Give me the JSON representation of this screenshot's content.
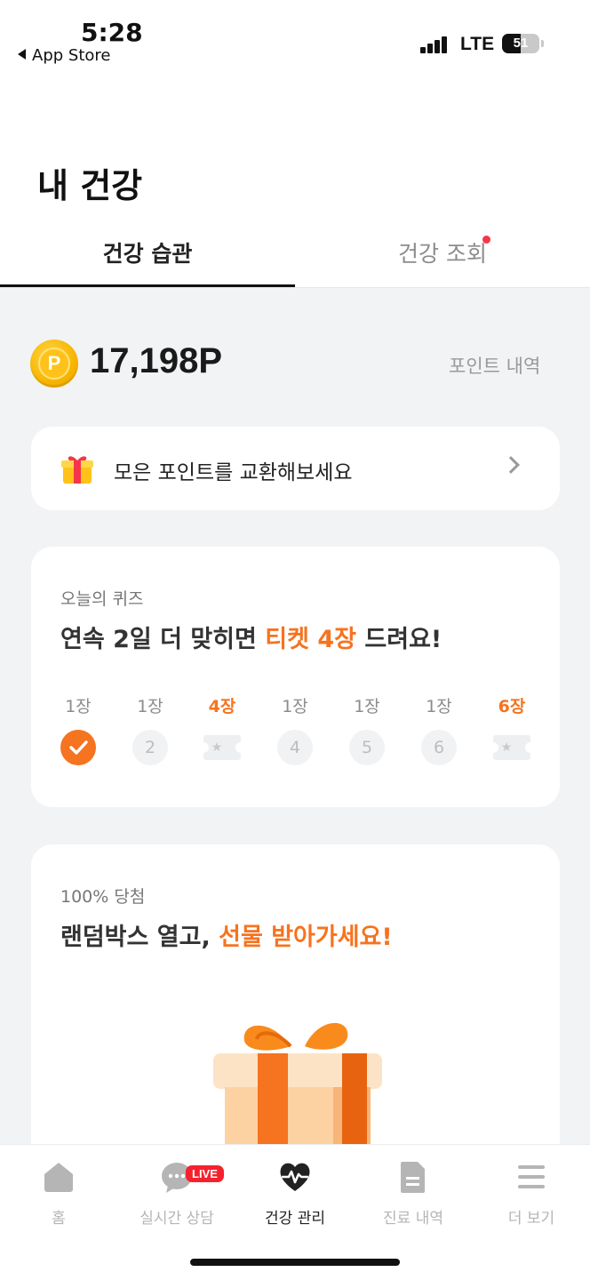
{
  "status_bar": {
    "time": "5:28",
    "back_label": "App Store",
    "network": "LTE",
    "battery": "51"
  },
  "header": {
    "title": "내 건강",
    "tabs": [
      {
        "label": "건강 습관",
        "active": true
      },
      {
        "label": "건강 조회",
        "active": false,
        "has_notification": true
      }
    ]
  },
  "points": {
    "coin_symbol": "P",
    "value": "17,198P",
    "history_label": "포인트 내역"
  },
  "exchange": {
    "label": "모은 포인트를 교환해보세요",
    "icon": "gift-icon"
  },
  "quiz": {
    "subtitle": "오늘의 퀴즈",
    "title_prefix": "연속 2일 더 맞히면 ",
    "title_highlight": "티켓 4장",
    "title_suffix": " 드려요!",
    "days": [
      {
        "reward": "1장",
        "marker": "",
        "state": "done"
      },
      {
        "reward": "1장",
        "marker": "2",
        "state": "upcoming"
      },
      {
        "reward": "4장",
        "marker": "★",
        "state": "ticket"
      },
      {
        "reward": "1장",
        "marker": "4",
        "state": "upcoming"
      },
      {
        "reward": "1장",
        "marker": "5",
        "state": "upcoming"
      },
      {
        "reward": "1장",
        "marker": "6",
        "state": "upcoming"
      },
      {
        "reward": "6장",
        "marker": "★",
        "state": "ticket"
      }
    ]
  },
  "random_box": {
    "subtitle": "100% 당첨",
    "title_prefix": "랜덤박스 열고, ",
    "title_highlight": "선물 받아가세요!"
  },
  "bottom_nav": {
    "items": [
      {
        "label": "홈",
        "icon": "home-icon",
        "active": false
      },
      {
        "label": "실시간 상담",
        "icon": "chat-icon",
        "active": false,
        "badge": "LIVE"
      },
      {
        "label": "건강 관리",
        "icon": "heart-pulse-icon",
        "active": true
      },
      {
        "label": "진료 내역",
        "icon": "document-icon",
        "active": false
      },
      {
        "label": "더 보기",
        "icon": "menu-icon",
        "active": false
      }
    ]
  },
  "colors": {
    "accent": "#f6731f",
    "notification": "#f5364a",
    "coin": "#f7b500",
    "background": "#f2f3f5"
  }
}
